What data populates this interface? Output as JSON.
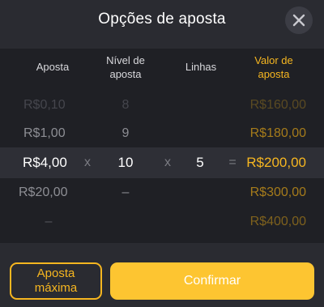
{
  "dialog": {
    "title": "Opções de aposta",
    "close_icon": "close-icon"
  },
  "columns": {
    "bet": "Aposta",
    "level": "Nível de aposta",
    "lines": "Linhas",
    "bet_value": "Valor de aposta"
  },
  "rows": [
    {
      "bet": "R$0,10",
      "level": "8",
      "lines": "",
      "bet_value": "R$160,00"
    },
    {
      "bet": "R$1,00",
      "level": "9",
      "lines": "",
      "bet_value": "R$180,00"
    },
    {
      "bet": "R$4,00",
      "level": "10",
      "lines": "5",
      "bet_value": "R$200,00"
    },
    {
      "bet": "R$20,00",
      "level": "–",
      "lines": "",
      "bet_value": "R$300,00"
    },
    {
      "bet": "–",
      "level": "",
      "lines": "",
      "bet_value": "R$400,00"
    }
  ],
  "selected_row_index": 2,
  "operators": {
    "multiply": "x",
    "equals": "="
  },
  "buttons": {
    "max_bet": "Aposta máxima",
    "confirm": "Confirmar"
  },
  "colors": {
    "accent": "#f6b620",
    "confirm_bg": "#fdc531",
    "background": "#2a2b31",
    "panel": "#1f2025"
  }
}
